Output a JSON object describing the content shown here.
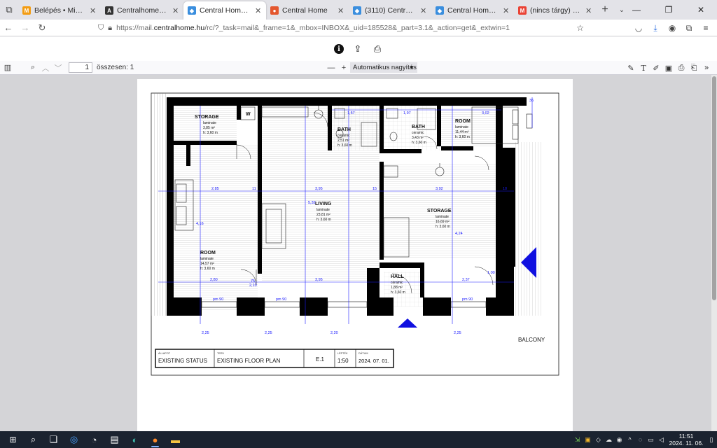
{
  "tabs": [
    {
      "title": "Belépés • MiniCRM",
      "icon_color": "#f39c12",
      "icon": "minicrm-icon"
    },
    {
      "title": "CentralhomeNextadmin",
      "icon_color": "#333333",
      "icon": "angular-icon"
    },
    {
      "title": "Central Home Webmail ::",
      "icon_color": "#3a8ede",
      "icon": "roundcube-icon",
      "active": true
    },
    {
      "title": "Central Home",
      "icon_color": "#e4572e",
      "icon": "site-icon"
    },
    {
      "title": "(3110) Central Home Web",
      "icon_color": "#3a8ede",
      "icon": "roundcube-icon"
    },
    {
      "title": "Central Home Webmail ::",
      "icon_color": "#3a8ede",
      "icon": "roundcube-icon"
    },
    {
      "title": "(nincs tárgy) - anita23160",
      "icon_color": "#ea4335",
      "icon": "gmail-icon"
    }
  ],
  "url": {
    "prefix": "https://mail.",
    "domain": "centralhome.hu",
    "rest": "/rc/?_task=mail&_frame=1&_mbox=INBOX&_uid=185528&_part=3.1&_action=get&_extwin=1"
  },
  "pdf": {
    "page": "1",
    "page_count": "összesen: 1",
    "zoom": "Automatikus nagyítás"
  },
  "plan": {
    "rooms": [
      {
        "name": "STORAGE",
        "material": "laminate",
        "area": "3,85 m²",
        "height": "h: 3,60 m"
      },
      {
        "name": "BATH",
        "material": "ceramic",
        "area": "2,51 m²",
        "height": "h: 3,60 m"
      },
      {
        "name": "BATH",
        "material": "ceramic",
        "area": "3,43 m²",
        "height": "h: 3,60 m"
      },
      {
        "name": "ROOM",
        "material": "laminate",
        "area": "11,44 m²",
        "height": "h: 3,60 m"
      },
      {
        "name": "LIVING",
        "material": "laminate",
        "area": "23,81 m²",
        "height": "h: 3,60 m"
      },
      {
        "name": "STORAGE",
        "material": "laminate",
        "area": "16,69 m²",
        "height": "h: 3,60 m"
      },
      {
        "name": "ROOM",
        "material": "laminate",
        "area": "14,57 m²",
        "height": "h: 3,60 m"
      },
      {
        "name": "HALL",
        "material": "ceramic",
        "area": "1,88 m²",
        "height": "h: 3,60 m"
      }
    ],
    "dims": {
      "d_285": "2,85",
      "d_395": "3,95",
      "d_392": "3,92",
      "d_280": "2,80",
      "d_395b": "3,95",
      "d_237": "2,37",
      "d_157": "1,57",
      "d_197": "1,97",
      "d_302": "3,02",
      "d_532": "5,32",
      "d_416": "4,16",
      "d_424": "4,24",
      "d_15": "15",
      "d_11": "11",
      "d_10": "10",
      "d_36": "36",
      "d_75": "75",
      "d_210": "2,10",
      "d_100": "1,00",
      "d_90": "pm 90",
      "d_225": "2,25",
      "d_220": "2,20"
    },
    "w_label": "W",
    "balcony": "BALCONY"
  },
  "titleblock": {
    "lbl_state": "ÁLLAPOT",
    "state": "EXISTING STATUS",
    "lbl_type": "TERV",
    "type": "EXISTING FLOOR PLAN",
    "sheet": "E.1",
    "lbl_scale": "LÉPTÉK",
    "scale": "1:50",
    "lbl_date": "DÁTUM",
    "date": "2024. 07. 01."
  },
  "clock": {
    "time": "11:51",
    "date": "2024. 11. 06."
  }
}
